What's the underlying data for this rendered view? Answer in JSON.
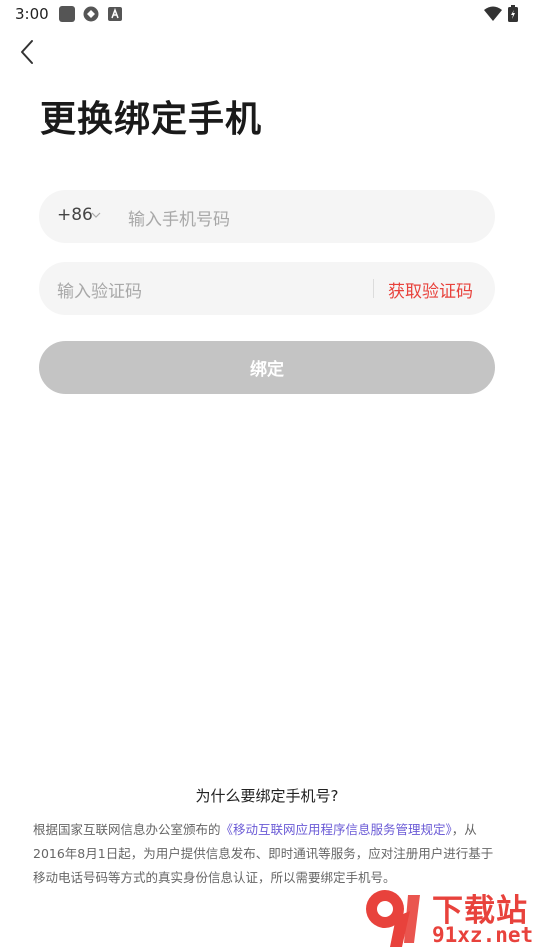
{
  "status_bar": {
    "time": "3:00"
  },
  "header": {
    "title": "更换绑定手机"
  },
  "phone": {
    "country_code": "+86",
    "placeholder": "输入手机号码"
  },
  "code": {
    "placeholder": "输入验证码",
    "get_code_label": "获取验证码"
  },
  "bind_button": {
    "label": "绑定"
  },
  "footer": {
    "question": "为什么要绑定手机号?",
    "desc_prefix": "根据国家互联网信息办公室颁布的",
    "desc_link": "《移动互联网应用程序信息服务管理规定》",
    "desc_suffix": "，从2016年8月1日起，为用户提供信息发布、即时通讯等服务，应对注册用户进行基于移动电话号码等方式的真实身份信息认证，所以需要绑定手机号。"
  },
  "watermark": {
    "cn_text": "下载站",
    "en_text": "91xz.net"
  },
  "colors": {
    "accent": "#e8423c",
    "link": "#6b5bd6",
    "button_disabled": "#c4c4c4",
    "field_bg": "#f5f5f5"
  }
}
